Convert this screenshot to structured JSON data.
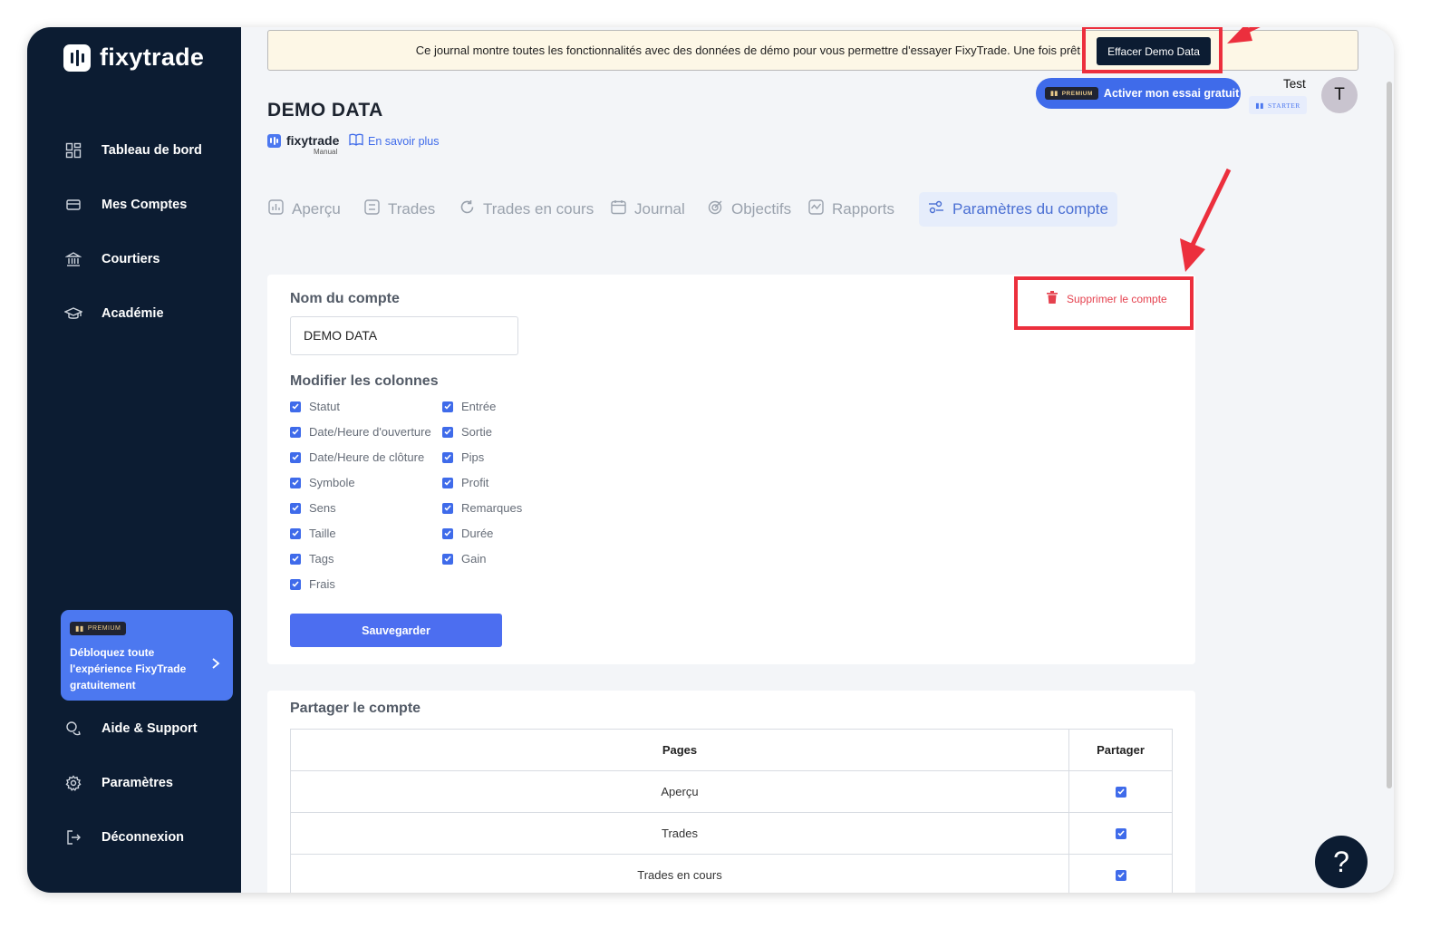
{
  "brand": {
    "name": "fixytrade"
  },
  "sidebar": {
    "items": [
      {
        "label": "Tableau de bord",
        "icon": "dashboard-icon"
      },
      {
        "label": "Mes Comptes",
        "icon": "accounts-icon"
      },
      {
        "label": "Courtiers",
        "icon": "bank-icon"
      },
      {
        "label": "Académie",
        "icon": "graduation-cap-icon"
      }
    ],
    "promo": {
      "badge": "PREMIUM",
      "text": "Débloquez toute l'expérience FixyTrade gratuitement"
    },
    "bottom_items": [
      {
        "label": "Aide & Support",
        "icon": "support-icon"
      },
      {
        "label": "Paramètres",
        "icon": "gear-icon"
      },
      {
        "label": "Déconnexion",
        "icon": "logout-icon"
      }
    ]
  },
  "banner": {
    "text": "Ce journal montre toutes les fonctionnalités avec des données de démo pour vous permettre d'essayer FixyTrade. Une fois prêt",
    "button": "Effacer Demo Data"
  },
  "header": {
    "trial_badge": "PREMIUM",
    "trial_button": "Activer mon essai gratuit",
    "user_name": "Test",
    "plan_badge": "STARTER",
    "avatar_initial": "T"
  },
  "page": {
    "title": "DEMO DATA",
    "sub_brand": "fixytrade",
    "sub_brand_note": "Manual",
    "learn_more": "En savoir plus"
  },
  "tabs": [
    {
      "label": "Aperçu",
      "icon": "chart-icon",
      "active": false
    },
    {
      "label": "Trades",
      "icon": "list-icon",
      "active": false
    },
    {
      "label": "Trades en cours",
      "icon": "refresh-icon",
      "active": false
    },
    {
      "label": "Journal",
      "icon": "calendar-icon",
      "active": false
    },
    {
      "label": "Objectifs",
      "icon": "target-icon",
      "active": false
    },
    {
      "label": "Rapports",
      "icon": "report-icon",
      "active": false
    },
    {
      "label": "Paramètres du compte",
      "icon": "settings-sliders-icon",
      "active": true
    }
  ],
  "account_settings": {
    "name_label": "Nom du compte",
    "name_value": "DEMO DATA",
    "delete_button": "Supprimer le compte",
    "columns_label": "Modifier les colonnes",
    "columns_left": [
      "Statut",
      "Date/Heure d'ouverture",
      "Date/Heure de clôture",
      "Symbole",
      "Sens",
      "Taille",
      "Tags",
      "Frais"
    ],
    "columns_right": [
      "Entrée",
      "Sortie",
      "Pips",
      "Profit",
      "Remarques",
      "Durée",
      "Gain"
    ],
    "save_button": "Sauvegarder"
  },
  "share": {
    "title": "Partager le compte",
    "headers": [
      "Pages",
      "Partager"
    ],
    "rows": [
      {
        "page": "Aperçu",
        "shared": true
      },
      {
        "page": "Trades",
        "shared": true
      },
      {
        "page": "Trades en cours",
        "shared": true
      }
    ]
  },
  "help": {
    "label": "?"
  },
  "colors": {
    "sidebar": "#0c1c32",
    "accent": "#4c78f0",
    "highlight": "#ec2f3d",
    "banner": "#fdf7e6"
  }
}
